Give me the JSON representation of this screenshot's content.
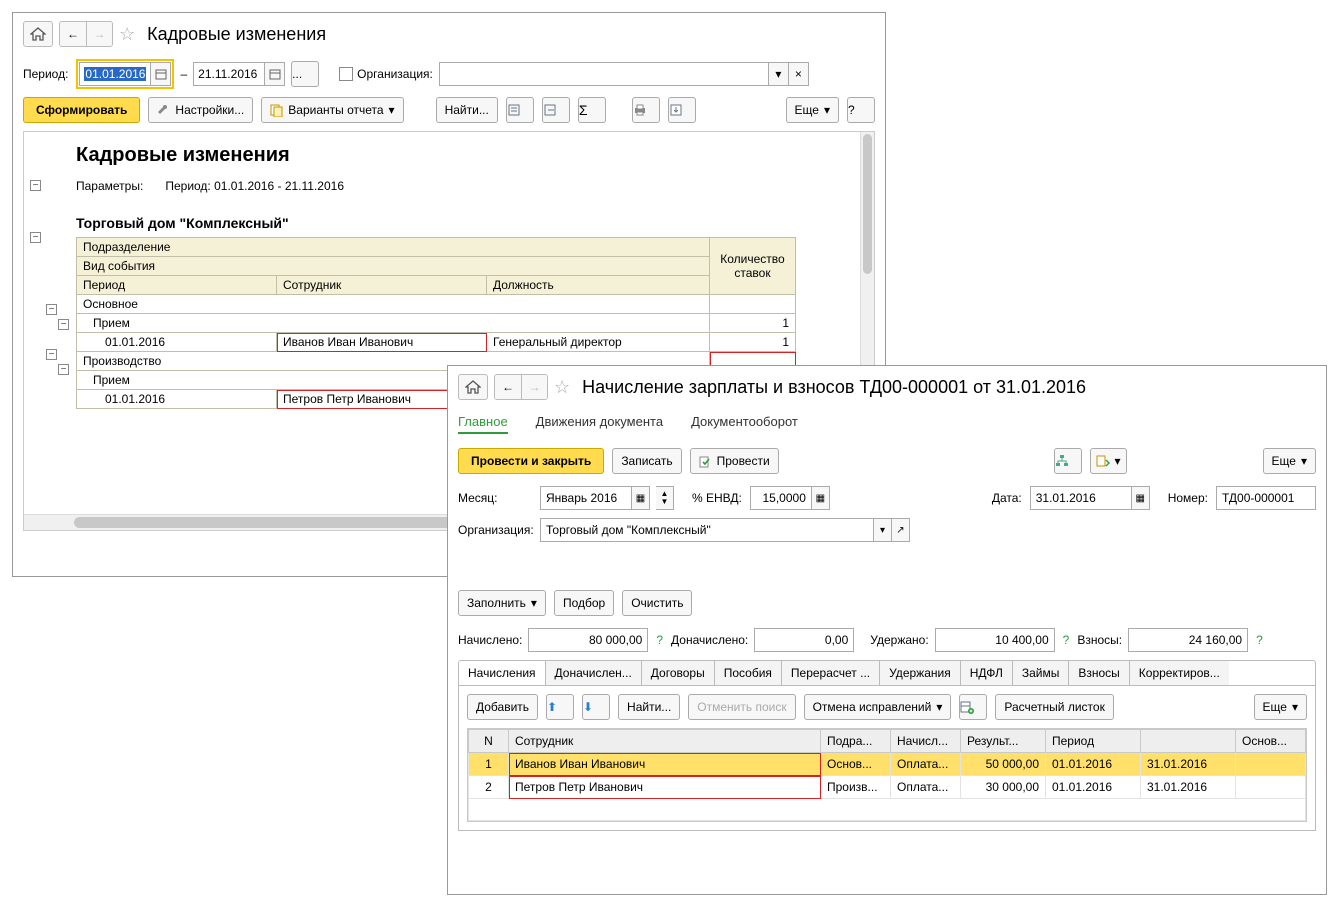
{
  "w1": {
    "title": "Кадровые изменения",
    "period_label": "Период:",
    "date_from": "01.01.2016",
    "date_to": "21.11.2016",
    "dots": "...",
    "dash": "–",
    "org_label": "Организация:",
    "btn_generate": "Сформировать",
    "btn_settings": "Настройки...",
    "btn_variants": "Варианты отчета",
    "btn_find": "Найти...",
    "btn_more": "Еще",
    "btn_help": "?",
    "report": {
      "title": "Кадровые изменения",
      "params_label": "Параметры:",
      "params_value": "Период: 01.01.2016 - 21.11.2016",
      "company": "Торговый дом \"Комплексный\"",
      "h_dept": "Подразделение",
      "h_event": "Вид события",
      "h_period": "Период",
      "h_employee": "Сотрудник",
      "h_position": "Должность",
      "h_count": "Количество ставок",
      "dept1": "Основное",
      "ev1": "Прием",
      "r1_date": "01.01.2016",
      "r1_emp": "Иванов Иван Иванович",
      "r1_pos": "Генеральный директор",
      "r1_cnt1": "1",
      "r1_cnt2": "1",
      "dept2": "Производство",
      "ev2": "Прием",
      "r2_date": "01.01.2016",
      "r2_emp": "Петров Петр Иванович"
    }
  },
  "w2": {
    "title": "Начисление зарплаты и взносов ТД00-000001 от 31.01.2016",
    "tab_main": "Главное",
    "tab_moves": "Движения документа",
    "tab_doc": "Документооборот",
    "btn_post_close": "Провести и закрыть",
    "btn_save": "Записать",
    "btn_post": "Провести",
    "btn_more": "Еще",
    "month_label": "Месяц:",
    "month_value": "Январь 2016",
    "envd_label": "% ЕНВД:",
    "envd_value": "15,0000",
    "date_label": "Дата:",
    "date_value": "31.01.2016",
    "num_label": "Номер:",
    "num_value": "ТД00-000001",
    "org_label": "Организация:",
    "org_value": "Торговый дом \"Комплексный\"",
    "btn_fill": "Заполнить",
    "btn_select": "Подбор",
    "btn_clear": "Очистить",
    "accrued_label": "Начислено:",
    "accrued": "80 000,00",
    "addaccr_label": "Доначислено:",
    "addaccr": "0,00",
    "withheld_label": "Удержано:",
    "withheld": "10 400,00",
    "contrib_label": "Взносы:",
    "contrib": "24 160,00",
    "subtabs": [
      "Начисления",
      "Доначислен...",
      "Договоры",
      "Пособия",
      "Перерасчет ...",
      "Удержания",
      "НДФЛ",
      "Займы",
      "Взносы",
      "Корректиров..."
    ],
    "tb_add": "Добавить",
    "tb_find": "Найти...",
    "tb_cancel": "Отменить поиск",
    "tb_undo": "Отмена исправлений",
    "tb_payslip": "Расчетный листок",
    "grid": {
      "h_n": "N",
      "h_emp": "Сотрудник",
      "h_dept": "Подра...",
      "h_accr": "Начисл...",
      "h_res": "Результ...",
      "h_period": "Период",
      "h_blank": "",
      "h_base": "Основ...",
      "rows": [
        {
          "n": "1",
          "emp": "Иванов Иван Иванович",
          "dept": "Основ...",
          "accr": "Оплата...",
          "res": "50 000,00",
          "p1": "01.01.2016",
          "p2": "31.01.2016"
        },
        {
          "n": "2",
          "emp": "Петров Петр Иванович",
          "dept": "Произв...",
          "accr": "Оплата...",
          "res": "30 000,00",
          "p1": "01.01.2016",
          "p2": "31.01.2016"
        }
      ]
    }
  },
  "icons": {
    "sigma": "Σ",
    "chev": "▾",
    "times": "×",
    "arrow_l": "←",
    "arrow_r": "→"
  }
}
